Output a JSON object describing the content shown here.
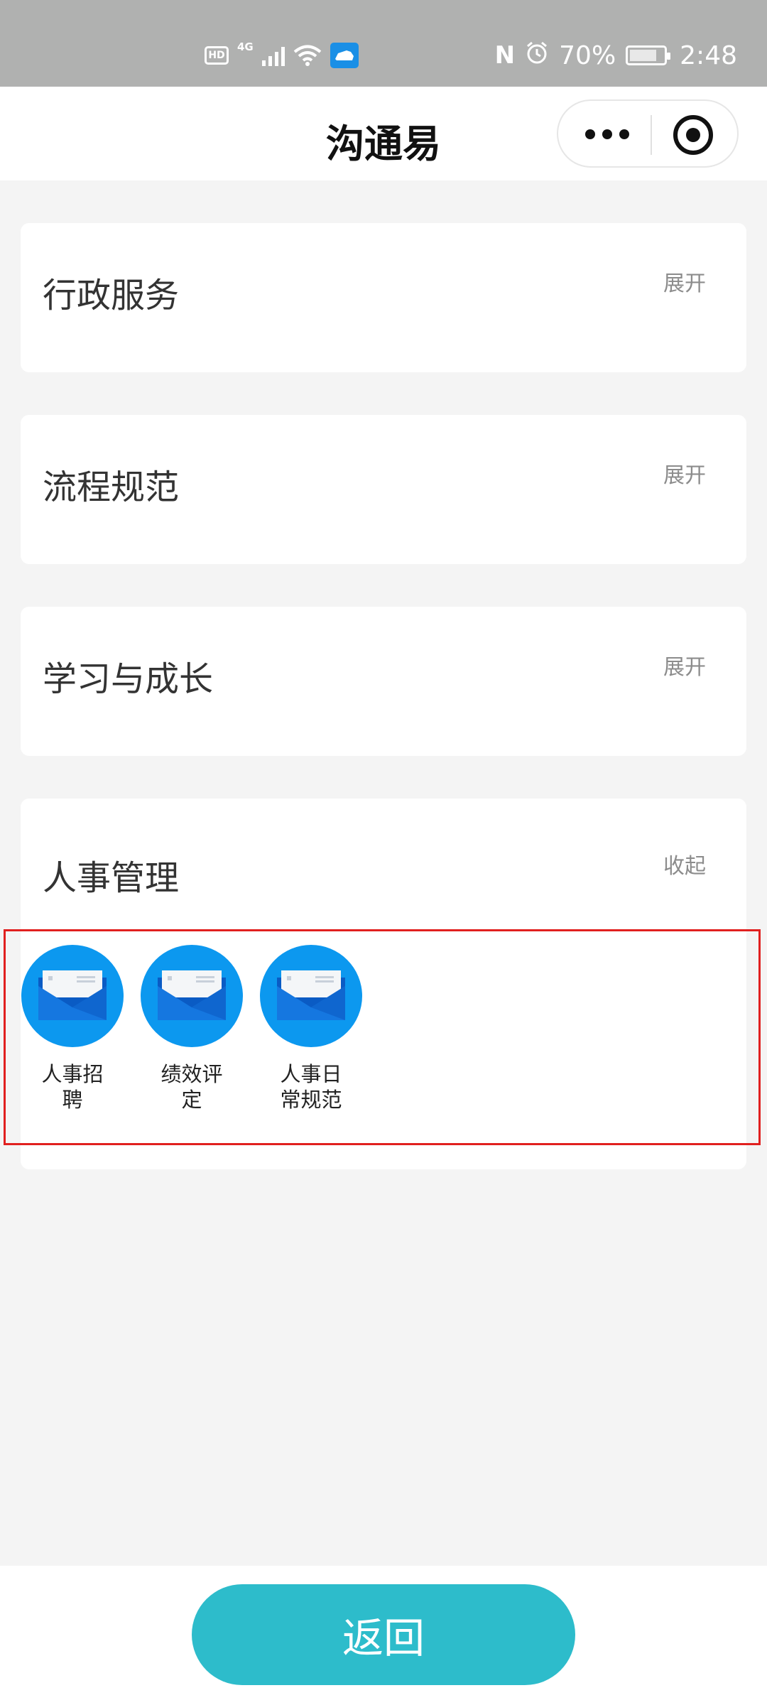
{
  "status_bar": {
    "hd": "HD",
    "network": "4G",
    "battery": "70%",
    "time": "2:48"
  },
  "nav": {
    "title": "沟通易"
  },
  "cards": [
    {
      "title": "行政服务",
      "toggle": "展开"
    },
    {
      "title": "流程规范",
      "toggle": "展开"
    },
    {
      "title": "学习与成长",
      "toggle": "展开"
    },
    {
      "title": "人事管理",
      "toggle": "收起"
    }
  ],
  "hr_items": [
    {
      "label": "人事招聘",
      "icon": "envelope-icon"
    },
    {
      "label": "绩效评定",
      "icon": "envelope-icon"
    },
    {
      "label": "人事日常规范",
      "icon": "envelope-icon"
    }
  ],
  "bottom": {
    "back_label": "返回"
  },
  "colors": {
    "accent": "#2dbccb",
    "icon_blue": "#0c98ef",
    "highlight": "#e1201f"
  }
}
